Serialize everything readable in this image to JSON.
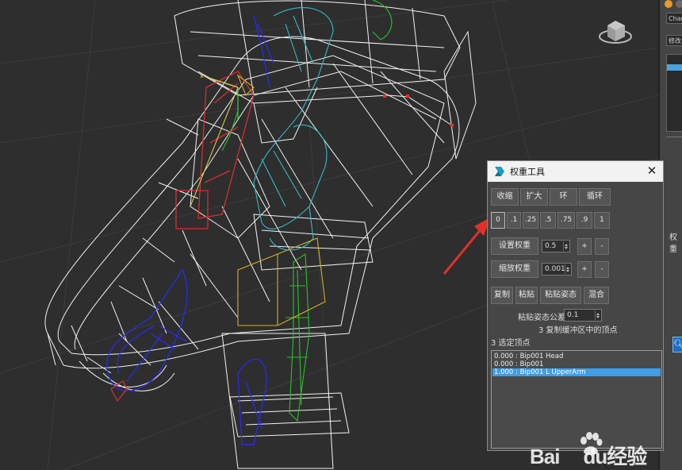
{
  "viewport": {
    "wireframe_colors": {
      "mesh": "#ffffff",
      "bone_blue": "#2a2aff",
      "bone_cyan": "#35b9c9",
      "bone_green": "#2cc02c",
      "bone_red": "#d23030",
      "bone_yellow": "#d4b02a",
      "selected_vertex": "#ff2a2a"
    }
  },
  "command_panel": {
    "field_top": "Chan",
    "field_modifier": "修改",
    "weight_label": "权重",
    "icons": [
      "viewcube-icon",
      "search-icon"
    ]
  },
  "dialog": {
    "title": "权重工具",
    "close": "✕",
    "row1": [
      "收缩",
      "扩大",
      "环",
      "循环"
    ],
    "presets": [
      "0",
      ".1",
      ".25",
      ".5",
      ".75",
      ".9",
      "1"
    ],
    "set_weight": {
      "label": "设置权重",
      "value": "0.5",
      "plus": "+",
      "minus": "-"
    },
    "scale_weight": {
      "label": "缩放权重",
      "value": "0.001",
      "plus": "+",
      "minus": "-"
    },
    "row4": [
      "复制",
      "粘贴",
      "粘贴姿态",
      "混合"
    ],
    "paste_tolerance": {
      "label": "粘贴姿态公差",
      "value": "0.1"
    },
    "copy_buffer_info": "3 复制缓冲区中的顶点",
    "selected_count": "3 选定顶点",
    "vertex_list": [
      {
        "text": "0.000 : Bip001 Head",
        "selected": false
      },
      {
        "text": "0.000 : Bip001",
        "selected": false
      },
      {
        "text": "1.000 : Bip001 L UpperArm",
        "selected": true
      }
    ]
  },
  "watermark": {
    "left": "Bai",
    "right": "du",
    "suffix": "经验"
  }
}
